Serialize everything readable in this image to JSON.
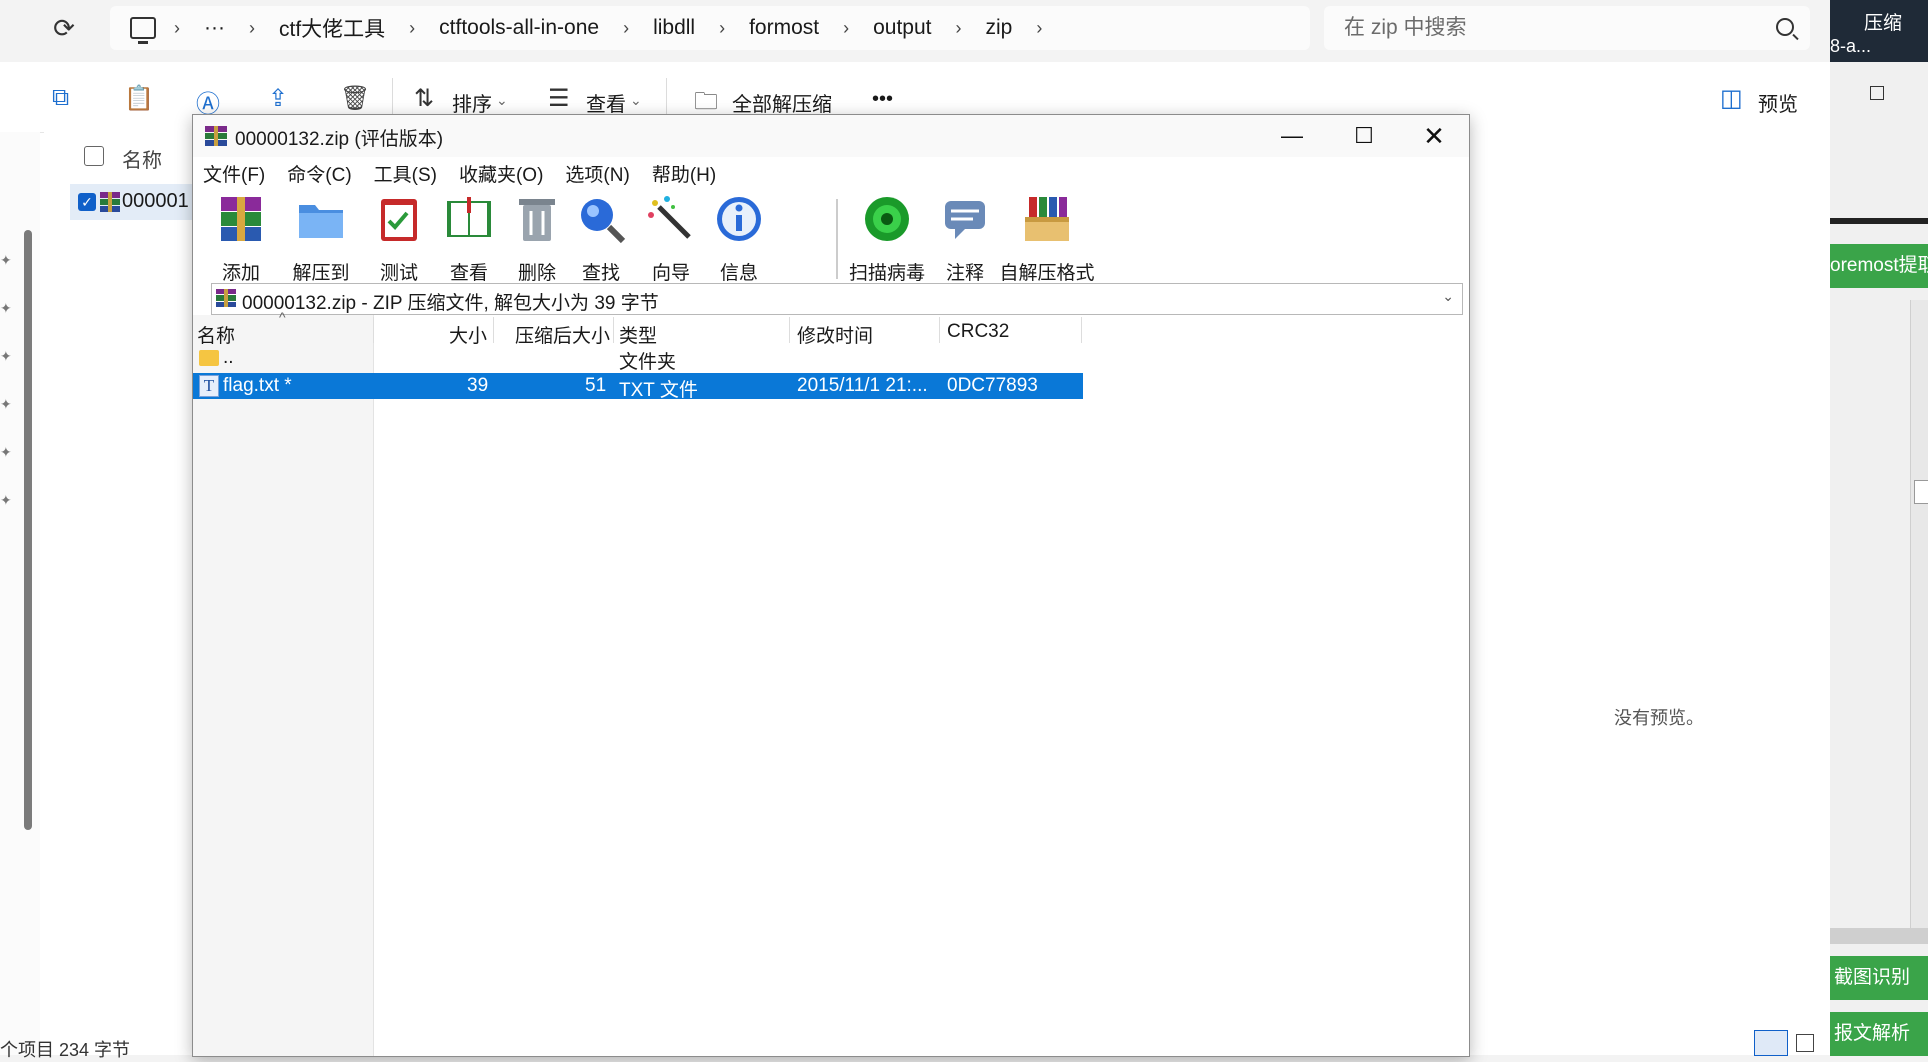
{
  "explorer": {
    "breadcrumbs": [
      "ctf大佬工具",
      "ctftools-all-in-one",
      "libdll",
      "formost",
      "output",
      "zip"
    ],
    "search_placeholder": "在 zip 中搜索",
    "toolbar": {
      "sort_label": "排序",
      "view_label": "查看",
      "extract_all_label": "全部解压缩",
      "more_label": "•••",
      "preview_label": "预览"
    },
    "column_name": "名称",
    "file_name": "000001",
    "no_preview": "没有预览。",
    "status": "个项目  234 字节"
  },
  "right_app": {
    "title": "压缩",
    "subtitle": "8-a...",
    "button_extract": "oremost提取",
    "button_ocr": "截图识别",
    "button_parse": "报文解析"
  },
  "winrar": {
    "title": "00000132.zip (评估版本)",
    "menu": [
      "文件(F)",
      "命令(C)",
      "工具(S)",
      "收藏夹(O)",
      "选项(N)",
      "帮助(H)"
    ],
    "tools": [
      "添加",
      "解压到",
      "测试",
      "查看",
      "删除",
      "查找",
      "向导",
      "信息",
      "扫描病毒",
      "注释",
      "自解压格式"
    ],
    "path_text": "00000132.zip - ZIP 压缩文件, 解包大小为 39 字节",
    "columns": {
      "name": "名称",
      "size": "大小",
      "packed": "压缩后大小",
      "type": "类型",
      "modified": "修改时间",
      "crc": "CRC32"
    },
    "rows": [
      {
        "name": "..",
        "size": "",
        "packed": "",
        "type": "文件夹",
        "modified": "",
        "crc": ""
      },
      {
        "name": "flag.txt *",
        "size": "39",
        "packed": "51",
        "type": "TXT 文件",
        "modified": "2015/11/1 21:...",
        "crc": "0DC77893"
      }
    ]
  },
  "colors": {
    "accent": "#0a78d7",
    "green": "#3aa449",
    "dark": "#1f2a37"
  }
}
